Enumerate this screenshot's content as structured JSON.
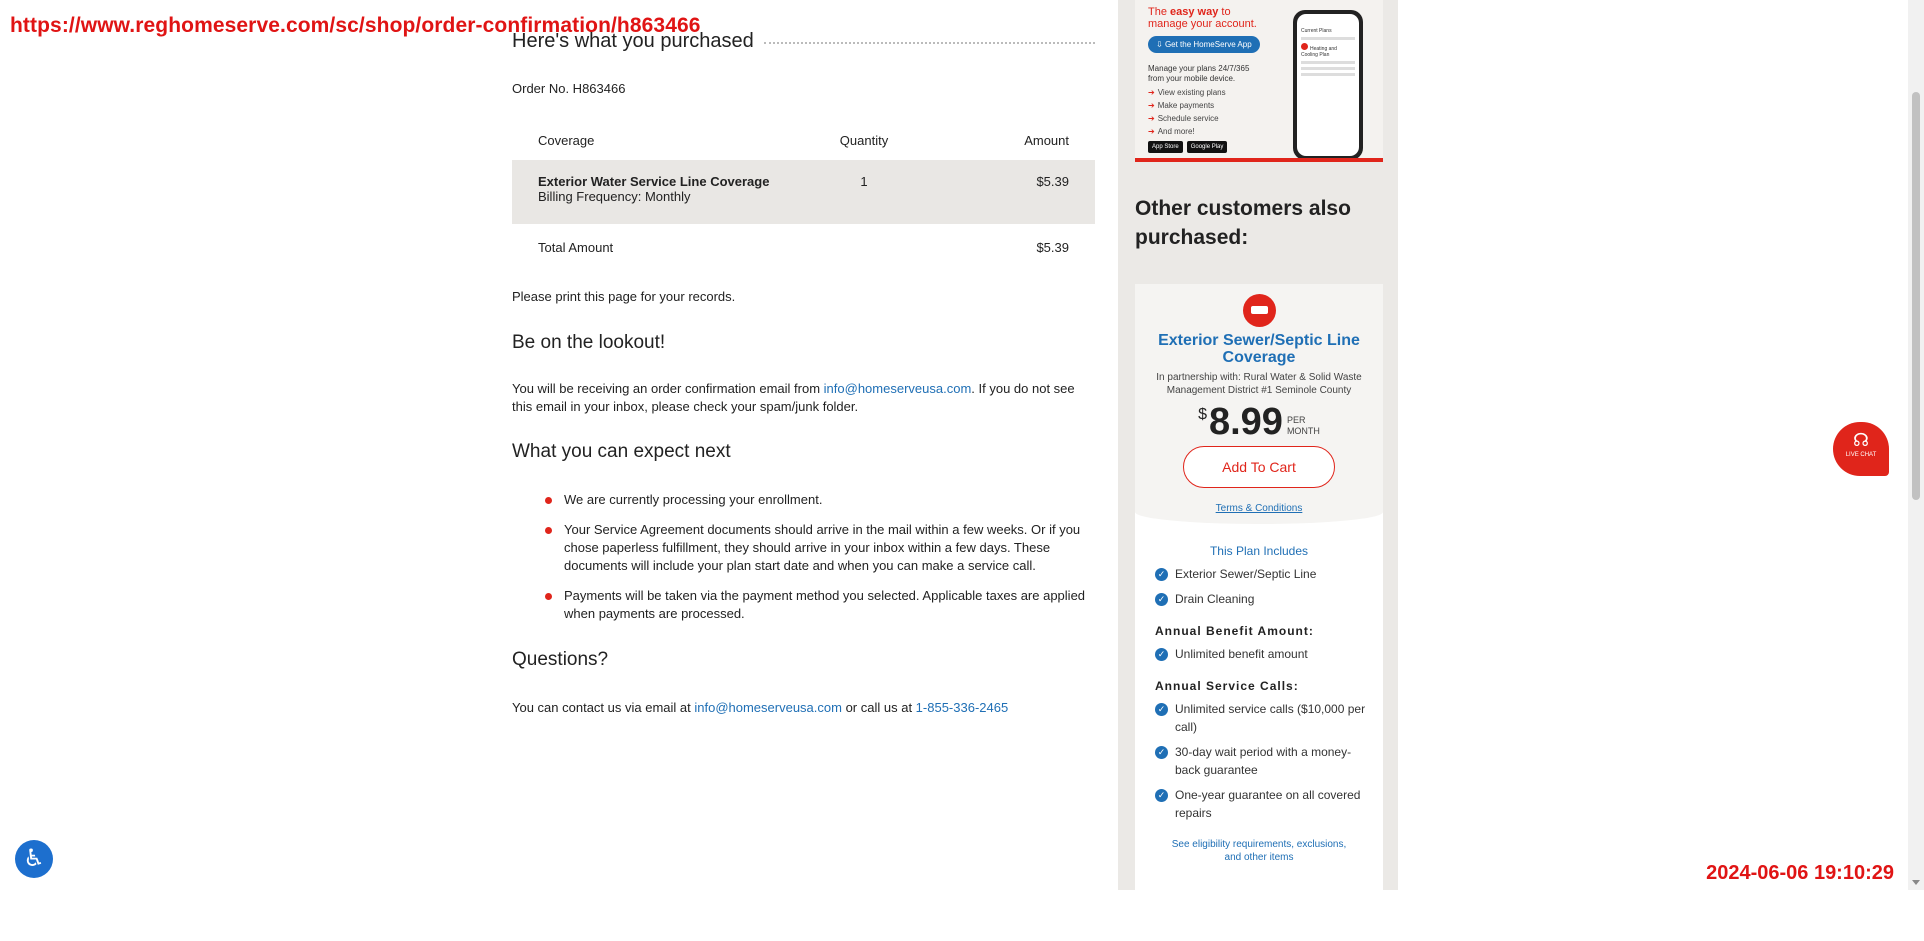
{
  "overlay": {
    "url": "https://www.reghomeserve.com/sc/shop/order-confirmation/h863466",
    "timestamp": "2024-06-06 19:10:29"
  },
  "purchase": {
    "heading": "Here's what you purchased",
    "order_no": "Order No. H863466",
    "columns": {
      "coverage": "Coverage",
      "quantity": "Quantity",
      "amount": "Amount"
    },
    "item": {
      "name": "Exterior Water Service Line Coverage",
      "billing": "Billing Frequency: Monthly",
      "quantity": "1",
      "amount": "$5.39"
    },
    "total_label": "Total Amount",
    "total_amount": "$5.39",
    "print_note": "Please print this page for your records."
  },
  "lookout": {
    "heading": "Be on the lookout!",
    "text_before": "You will be receiving an order confirmation email from ",
    "email": "info@homeserveusa.com",
    "text_after": ". If you do not see this email in your inbox, please check your spam/junk folder."
  },
  "next": {
    "heading": "What you can expect next",
    "items": [
      "We are currently processing your enrollment.",
      "Your Service Agreement documents should arrive in the mail within a few weeks. Or if you chose paperless fulfillment, they should arrive in your inbox within a few days. These documents will include your plan start date and when you can make a service call.",
      "Payments will be taken via the payment method you selected. Applicable taxes are applied when payments are processed."
    ]
  },
  "questions": {
    "heading": "Questions?",
    "text_before": "You can contact us via email at ",
    "email": "info@homeserveusa.com",
    "text_middle": " or call us at ",
    "phone": "1-855-336-2465"
  },
  "promo": {
    "tag_prefix": "The ",
    "tag_bold": "easy way",
    "tag_suffix": " to",
    "tag_line2": "manage your account.",
    "app_button": "Get the HomeServe App",
    "sub_line1": "Manage your plans 24/7/365",
    "sub_line2": "from your mobile device.",
    "list": [
      "View existing plans",
      "Make payments",
      "Schedule service",
      "And more!"
    ],
    "store_apple": "App Store",
    "store_google": "Google Play",
    "phone_title": "Current Plans",
    "phone_item": "Heating and Cooling Plan"
  },
  "also": {
    "heading": "Other customers also purchased:"
  },
  "card": {
    "title": "Exterior Sewer/Septic Line Coverage",
    "partner": "In partnership with: Rural Water & Solid Waste Management District #1 Seminole County",
    "currency": "$",
    "price": "8.99",
    "per_line1": "PER",
    "per_line2": "MONTH",
    "add_to_cart": "Add To Cart",
    "terms": "Terms & Conditions",
    "includes_heading": "This Plan Includes",
    "includes": [
      "Exterior Sewer/Septic Line",
      "Drain Cleaning"
    ],
    "benefit_heading": "Annual Benefit Amount:",
    "benefit": [
      "Unlimited benefit amount"
    ],
    "calls_heading": "Annual Service Calls:",
    "calls": [
      "Unlimited service calls ($10,000 per call)",
      "30-day wait period with a money-back guarantee",
      "One-year guarantee on all covered repairs"
    ],
    "eligibility": "See eligibility requirements, exclusions, and other items"
  },
  "chat": {
    "label": "LIVE CHAT",
    "icon": "headset-icon"
  },
  "accessibility": {
    "icon": "accessibility-icon"
  },
  "colors": {
    "brand_red": "#e0251b",
    "link_blue": "#1f6fb5",
    "sidebar_bg": "#ebe9e6"
  }
}
